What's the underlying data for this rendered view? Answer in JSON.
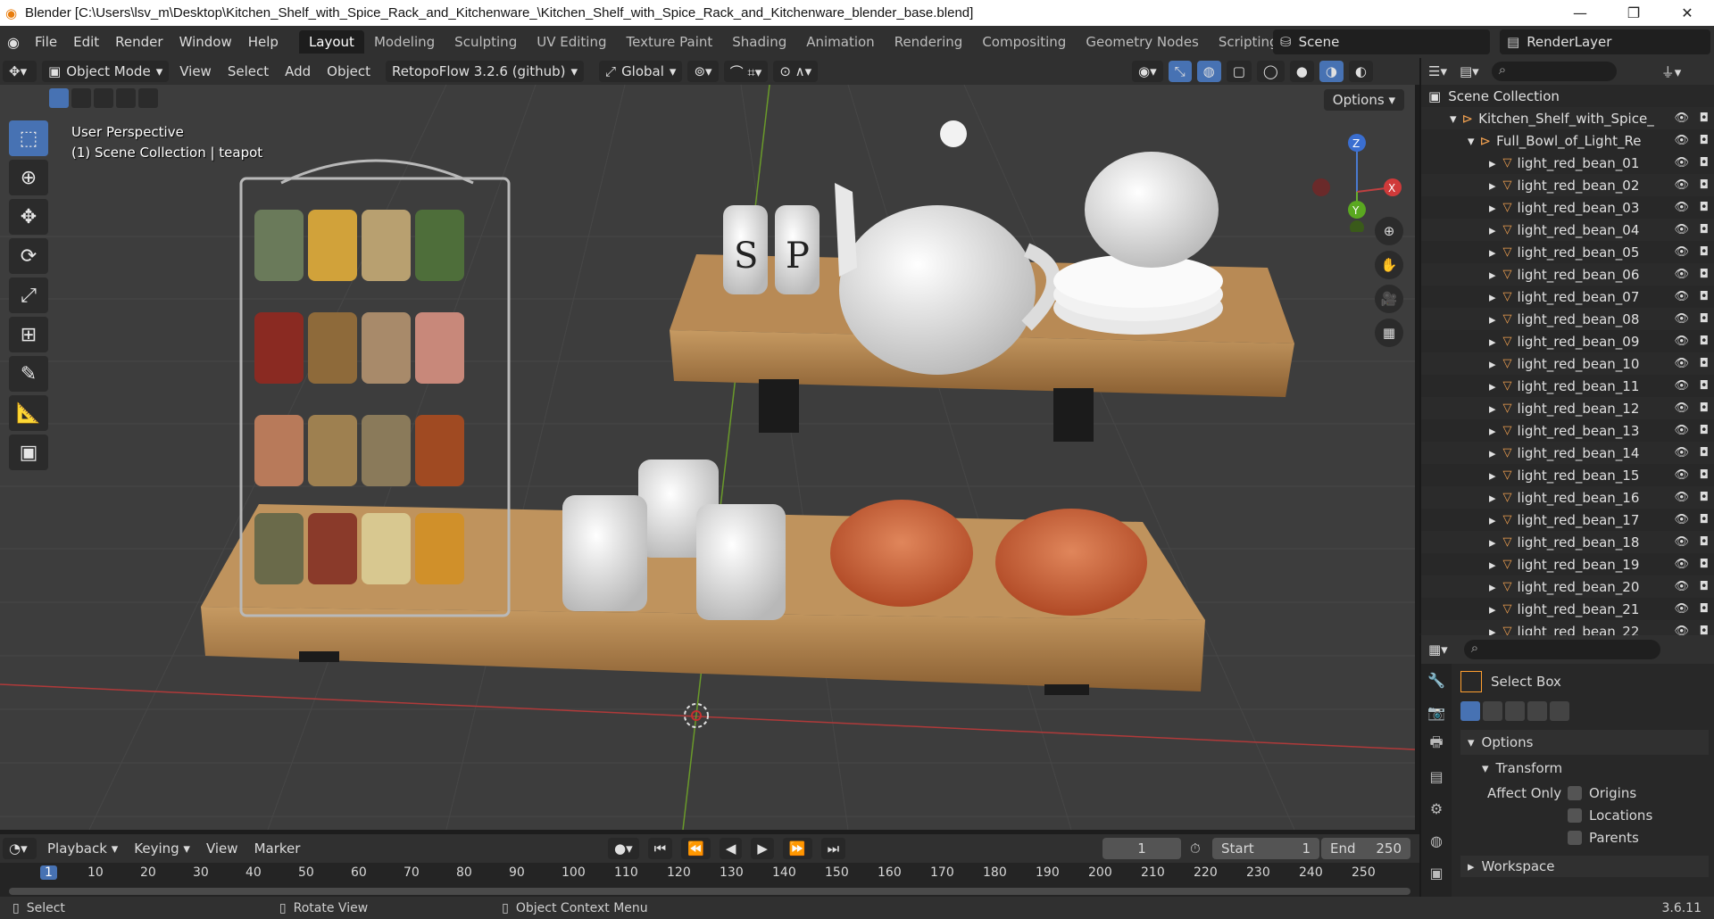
{
  "titlebar": {
    "title": "Blender [C:\\Users\\lsv_m\\Desktop\\Kitchen_Shelf_with_Spice_Rack_and_Kitchenware_\\Kitchen_Shelf_with_Spice_Rack_and_Kitchenware_blender_base.blend]",
    "minimize": "—",
    "maximize": "❐",
    "close": "✕"
  },
  "menus": [
    "File",
    "Edit",
    "Render",
    "Window",
    "Help"
  ],
  "workspaces": [
    "Layout",
    "Modeling",
    "Sculpting",
    "UV Editing",
    "Texture Paint",
    "Shading",
    "Animation",
    "Rendering",
    "Compositing",
    "Geometry Nodes",
    "Scripting"
  ],
  "active_workspace": "Layout",
  "scene": "Scene",
  "render_layer": "RenderLayer",
  "viewport_header": {
    "mode": "Object Mode",
    "menus": [
      "View",
      "Select",
      "Add",
      "Object"
    ],
    "addon": "RetopoFlow 3.2.6 (github)",
    "orientation": "Global",
    "options": "Options"
  },
  "viewport_info": {
    "perspective": "User Perspective",
    "collection": "(1) Scene Collection | teapot"
  },
  "gizmo": {
    "z": "Z",
    "y": "Y",
    "x": "X"
  },
  "outliner": {
    "root": "Scene Collection",
    "collection": "Kitchen_Shelf_with_Spice_",
    "subcollection": "Full_Bowl_of_Light_Re",
    "items": [
      "light_red_bean_01",
      "light_red_bean_02",
      "light_red_bean_03",
      "light_red_bean_04",
      "light_red_bean_05",
      "light_red_bean_06",
      "light_red_bean_07",
      "light_red_bean_08",
      "light_red_bean_09",
      "light_red_bean_10",
      "light_red_bean_11",
      "light_red_bean_12",
      "light_red_bean_13",
      "light_red_bean_14",
      "light_red_bean_15",
      "light_red_bean_16",
      "light_red_bean_17",
      "light_red_bean_18",
      "light_red_bean_19",
      "light_red_bean_20",
      "light_red_bean_21",
      "light_red_bean_22"
    ]
  },
  "properties": {
    "tool": "Select Box",
    "options": "Options",
    "transform": "Transform",
    "affect_only": "Affect Only",
    "origins": "Origins",
    "locations": "Locations",
    "parents": "Parents",
    "workspace": "Workspace"
  },
  "timeline": {
    "menus": [
      "Playback",
      "Keying",
      "View",
      "Marker"
    ],
    "current_frame": "1",
    "start_label": "Start",
    "start": "1",
    "end_label": "End",
    "end": "250",
    "ruler": [
      "1",
      "10",
      "20",
      "30",
      "40",
      "50",
      "60",
      "70",
      "80",
      "90",
      "100",
      "110",
      "120",
      "130",
      "140",
      "150",
      "160",
      "170",
      "180",
      "190",
      "200",
      "210",
      "220",
      "230",
      "240",
      "250"
    ]
  },
  "statusbar": {
    "select": "Select",
    "rotate": "Rotate View",
    "context": "Object Context Menu",
    "version": "3.6.11"
  },
  "scene_labels": {
    "salt": "S",
    "pepper": "P"
  }
}
